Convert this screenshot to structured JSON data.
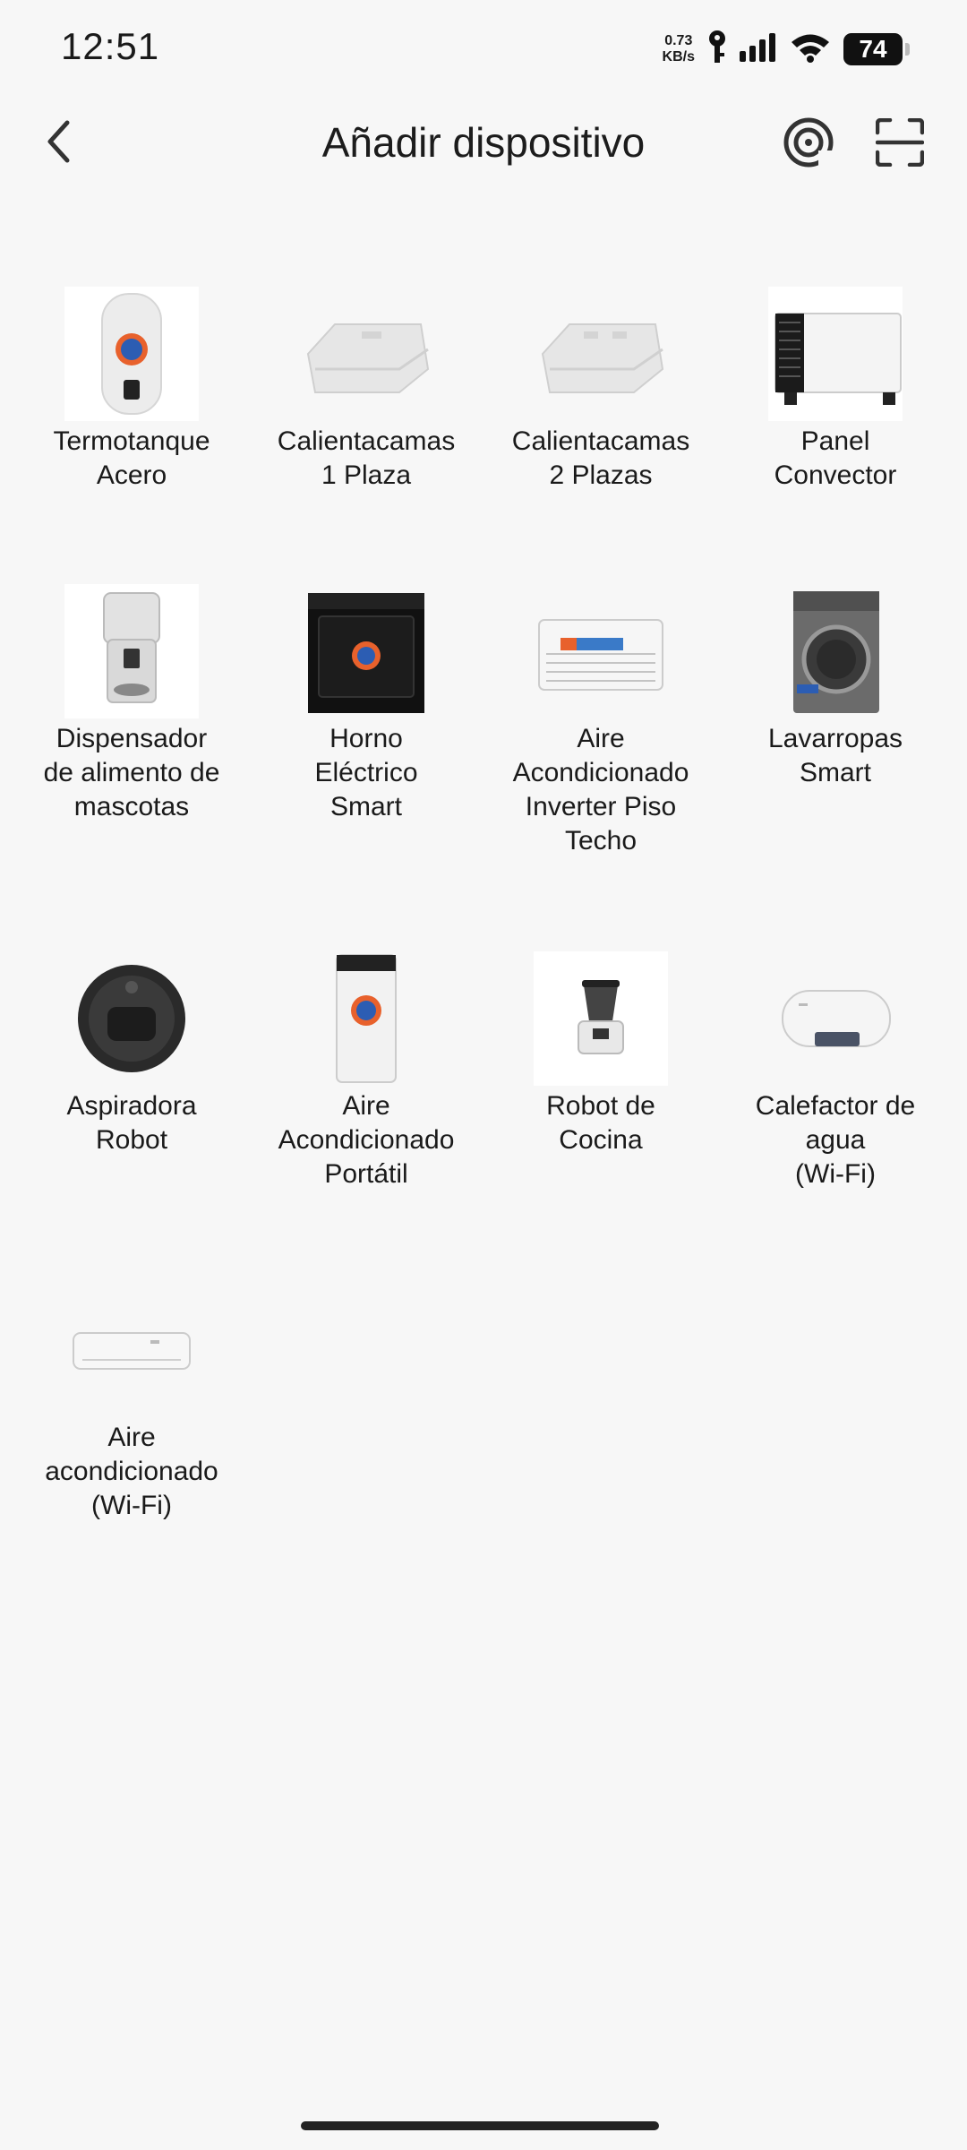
{
  "status_bar": {
    "time": "12:51",
    "speed_value": "0.73",
    "speed_unit": "KB/s",
    "battery": "74"
  },
  "header": {
    "title": "Añadir dispositivo"
  },
  "devices": [
    {
      "label": "Termotanque\nAcero",
      "icon": "water-heater-icon"
    },
    {
      "label": "Calientacamas\n1 Plaza",
      "icon": "electric-blanket-icon"
    },
    {
      "label": "Calientacamas\n2 Plazas",
      "icon": "electric-blanket-icon"
    },
    {
      "label": "Panel\nConvector",
      "icon": "convector-panel-icon"
    },
    {
      "label": "Dispensador\nde alimento de\nmascotas",
      "icon": "pet-feeder-icon"
    },
    {
      "label": "Horno\nEléctrico\nSmart",
      "icon": "oven-icon"
    },
    {
      "label": "Aire\nAcondicionado\nInverter Piso\nTecho",
      "icon": "ceiling-ac-icon"
    },
    {
      "label": "Lavarropas\nSmart",
      "icon": "washing-machine-icon"
    },
    {
      "label": "Aspiradora\nRobot",
      "icon": "robot-vacuum-icon"
    },
    {
      "label": "Aire\nAcondicionado\nPortátil",
      "icon": "portable-ac-icon"
    },
    {
      "label": "Robot de\nCocina",
      "icon": "kitchen-robot-icon"
    },
    {
      "label": "Calefactor de\nagua\n(Wi-Fi)",
      "icon": "horizontal-water-heater-icon"
    },
    {
      "label": "Aire\nacondicionado\n(Wi-Fi)",
      "icon": "split-ac-icon"
    }
  ]
}
